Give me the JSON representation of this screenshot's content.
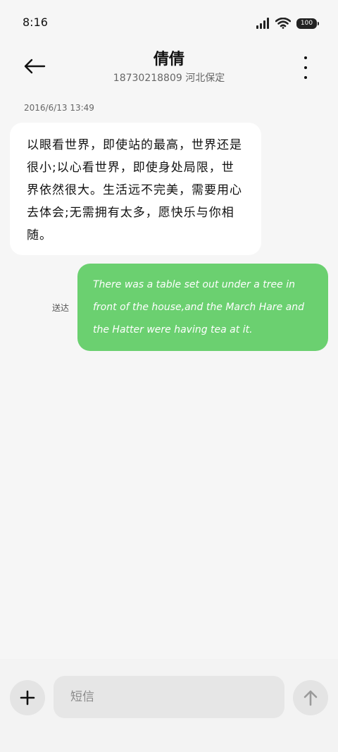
{
  "status_bar": {
    "time": "8:16",
    "battery_level": "100",
    "icons": [
      "signal-icon",
      "wifi-icon",
      "battery-icon"
    ]
  },
  "header": {
    "contact_name": "倩倩",
    "contact_meta": "18730218809  河北保定",
    "icons": [
      "back-arrow-icon",
      "more-vertical-icon"
    ]
  },
  "conversation": {
    "timestamp": "2016/6/13  13:49",
    "incoming_message": "以眼看世界，即使站的最高，世界还是很小;以心看世界，即使身处局限，世界依然很大。生活远不完美，需要用心去体会;无需拥有太多，愿快乐与你相随。",
    "outgoing_message": "There was a table set out under a tree in front of the house,and the March Hare and the Hatter were having tea at it.",
    "outgoing_status": "送达",
    "colors": {
      "incoming_bubble": "#ffffff",
      "outgoing_bubble": "#6bd070"
    }
  },
  "composer": {
    "placeholder": "短信",
    "icons": [
      "plus-icon",
      "send-arrow-up-icon"
    ]
  }
}
